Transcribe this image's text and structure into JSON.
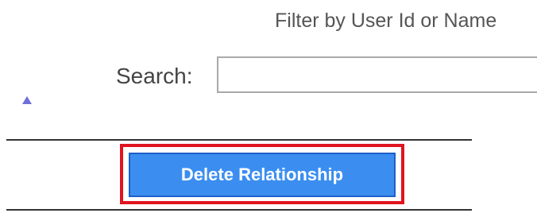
{
  "filter": {
    "caption": "Filter by User Id or Name"
  },
  "search": {
    "label": "Search:",
    "value": "",
    "placeholder": ""
  },
  "table": {
    "sort_indicator_icon": "sort-ascending-icon"
  },
  "actions": {
    "delete_relationship_label": "Delete Relationship"
  },
  "colors": {
    "button_bg": "#3b8ef0",
    "highlight": "#e0141e",
    "sort_icon": "#6f6fd8"
  }
}
